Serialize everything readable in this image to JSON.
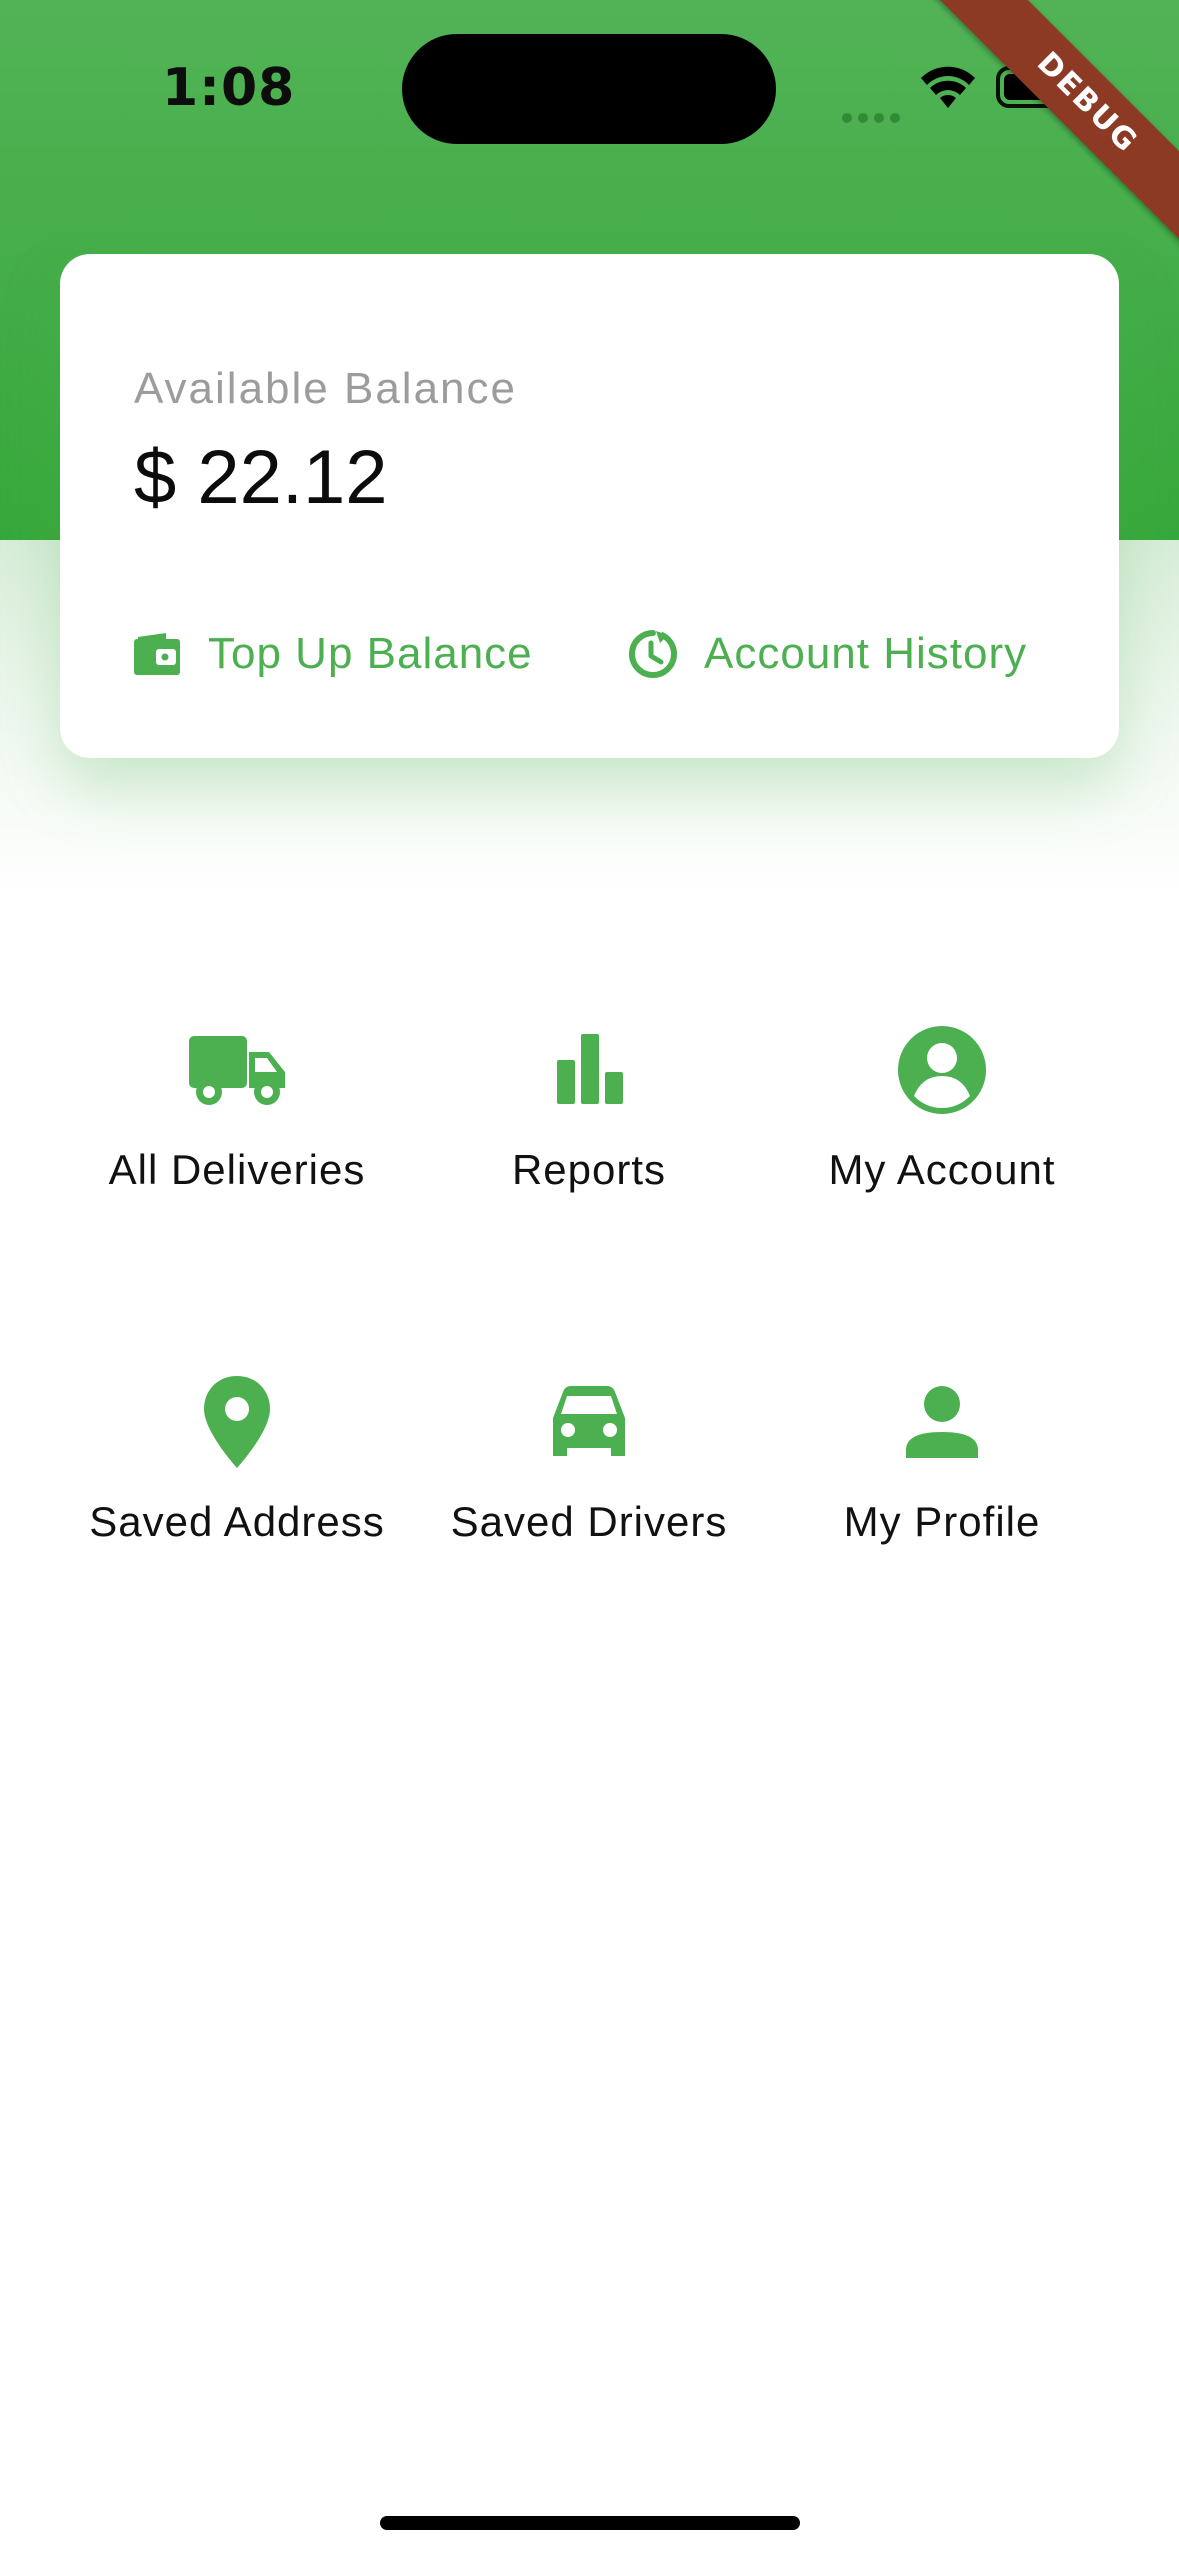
{
  "status_bar": {
    "time": "1:08"
  },
  "debug_banner": {
    "label": "DEBUG"
  },
  "balance_card": {
    "label": "Available Balance",
    "amount": "$ 22.12",
    "actions": [
      {
        "label": "Top Up Balance",
        "icon": "wallet-icon"
      },
      {
        "label": "Account History",
        "icon": "history-icon"
      }
    ]
  },
  "menu": {
    "items": [
      {
        "label": "All Deliveries",
        "icon": "truck-icon"
      },
      {
        "label": "Reports",
        "icon": "bar-chart-icon"
      },
      {
        "label": "My Account",
        "icon": "account-circle-icon"
      },
      {
        "label": "Saved Address",
        "icon": "location-pin-icon"
      },
      {
        "label": "Saved Drivers",
        "icon": "car-icon"
      },
      {
        "label": "My Profile",
        "icon": "person-icon"
      }
    ]
  },
  "colors": {
    "primary": "#4caf50",
    "header_top": "#52b356",
    "header_bottom": "#37a83b",
    "debug_ribbon": "#8c3a24"
  }
}
